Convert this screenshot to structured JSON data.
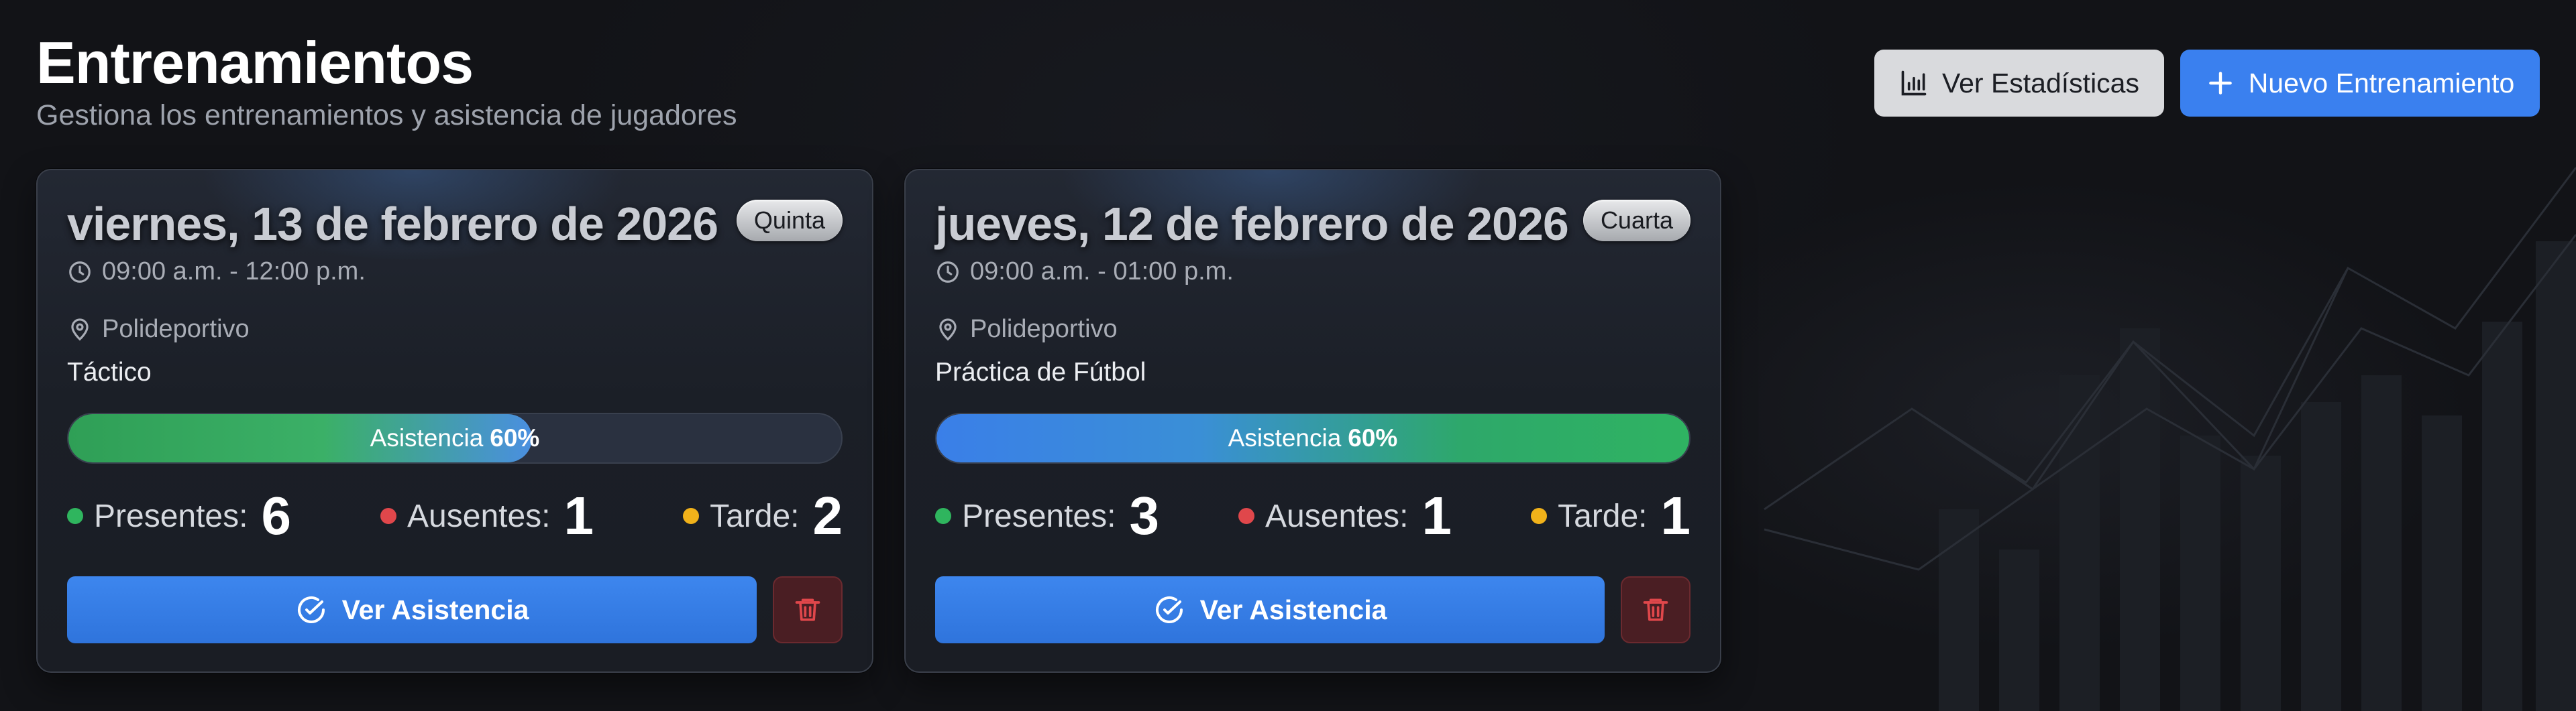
{
  "header": {
    "title": "Entrenamientos",
    "subtitle": "Gestiona los entrenamientos y asistencia de jugadores"
  },
  "actions": {
    "stats_label": "Ver Estadísticas",
    "new_label": "Nuevo Entrenamiento"
  },
  "colors": {
    "primary": "#3a80ef",
    "present": "#2fb55e",
    "absent": "#e0474b",
    "late": "#f1b21a",
    "danger": "#e0474b"
  },
  "cards": [
    {
      "date": "viernes, 13 de febrero de 2026",
      "badge": "Quinta",
      "time": "09:00 a.m. - 12:00 p.m.",
      "location": "Polideportivo",
      "type": "Táctico",
      "attendance_label": "Asistencia",
      "attendance_value": "60%",
      "attendance_percent": 60,
      "present_label": "Presentes:",
      "present_count": "6",
      "absent_label": "Ausentes:",
      "absent_count": "1",
      "late_label": "Tarde:",
      "late_count": "2",
      "view_label": "Ver Asistencia"
    },
    {
      "date": "jueves, 12 de febrero de 2026",
      "badge": "Cuarta",
      "time": "09:00 a.m. - 01:00 p.m.",
      "location": "Polideportivo",
      "type": "Práctica de Fútbol",
      "attendance_label": "Asistencia",
      "attendance_value": "60%",
      "attendance_percent": 100,
      "present_label": "Presentes:",
      "present_count": "3",
      "absent_label": "Ausentes:",
      "absent_count": "1",
      "late_label": "Tarde:",
      "late_count": "1",
      "view_label": "Ver Asistencia"
    }
  ],
  "icons": {
    "stats": "bar-chart-icon",
    "new": "plus-icon",
    "time": "clock-icon",
    "location": "map-pin-icon",
    "view": "check-circle-icon",
    "delete": "trash-icon"
  }
}
